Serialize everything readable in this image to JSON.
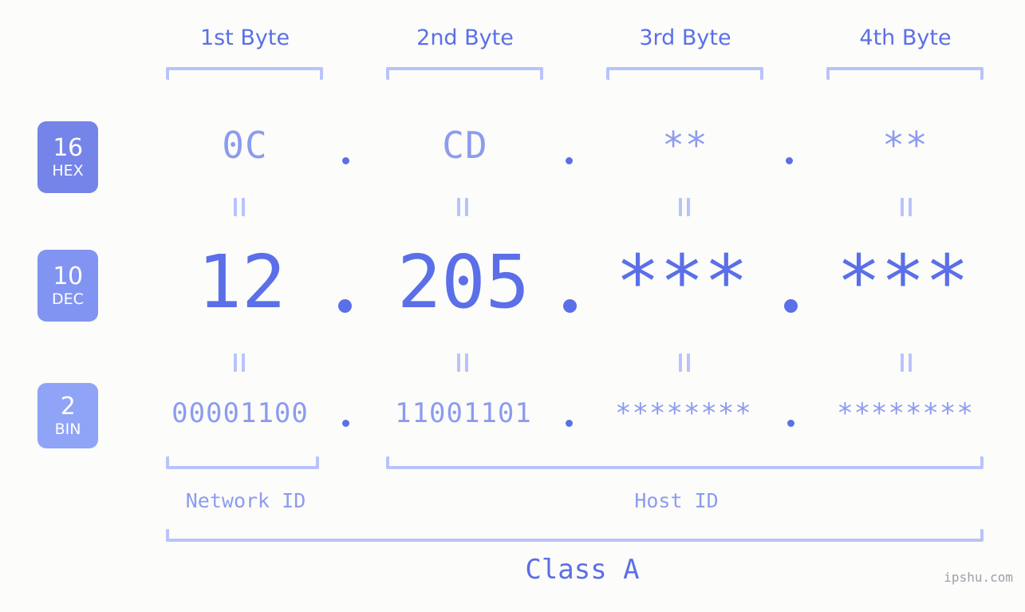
{
  "meta": {
    "watermark": "ipshu.com",
    "background_color": "#fcfdfa",
    "accent_color": "#5b6fe8",
    "light_accent_color": "#8d9bef",
    "bracket_color": "#b9c3fb"
  },
  "byte_headers": [
    {
      "label": "1st Byte"
    },
    {
      "label": "2nd Byte"
    },
    {
      "label": "3rd Byte"
    },
    {
      "label": "4th Byte"
    }
  ],
  "bases": [
    {
      "num": "16",
      "name": "HEX",
      "color": "#7584e8"
    },
    {
      "num": "10",
      "name": "DEC",
      "color": "#8294f2"
    },
    {
      "num": "2",
      "name": "BIN",
      "color": "#8fa4f7"
    }
  ],
  "separator": ".",
  "rows": {
    "hex": {
      "base_label": "HEX",
      "values": [
        "0C",
        "CD",
        "**",
        "**"
      ]
    },
    "dec": {
      "base_label": "DEC",
      "values": [
        "12",
        "205",
        "***",
        "***"
      ]
    },
    "bin": {
      "base_label": "BIN",
      "values": [
        "00001100",
        "11001101",
        "********",
        "********"
      ]
    }
  },
  "regions": {
    "network_id": "Network ID",
    "host_id": "Host ID",
    "class": "Class A"
  },
  "chart_data": {
    "type": "table",
    "title": "IP address byte breakdown",
    "categories": [
      "1st Byte",
      "2nd Byte",
      "3rd Byte",
      "4th Byte"
    ],
    "series": [
      {
        "name": "HEX",
        "values": [
          "0C",
          "CD",
          "**",
          "**"
        ]
      },
      {
        "name": "DEC",
        "values": [
          "12",
          "205",
          "***",
          "***"
        ]
      },
      {
        "name": "BIN",
        "values": [
          "00001100",
          "11001101",
          "********",
          "********"
        ]
      }
    ],
    "annotations": [
      "Network ID",
      "Host ID",
      "Class A"
    ]
  }
}
